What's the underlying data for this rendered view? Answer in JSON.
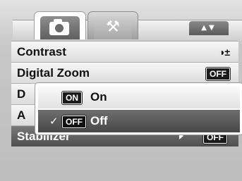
{
  "tabs": [
    {
      "name": "camera",
      "icon": "camera-icon",
      "active": true
    },
    {
      "name": "setup",
      "icon": "wrench-screwdriver-icon",
      "active": false
    }
  ],
  "nav_arrows": "▲▼",
  "menu": {
    "rows": [
      {
        "label": "Contrast",
        "value": "◑±"
      },
      {
        "label": "Digital Zoom",
        "value": "OFF"
      },
      {
        "label": "D",
        "value": ""
      },
      {
        "label": "A",
        "value": ""
      },
      {
        "label": "Stabilizer",
        "value": "OFF"
      }
    ]
  },
  "popup": {
    "options": [
      {
        "badge": "ON",
        "label": "On",
        "selected": false
      },
      {
        "badge": "OFF",
        "label": "Off",
        "selected": true,
        "check": "✓"
      }
    ]
  }
}
